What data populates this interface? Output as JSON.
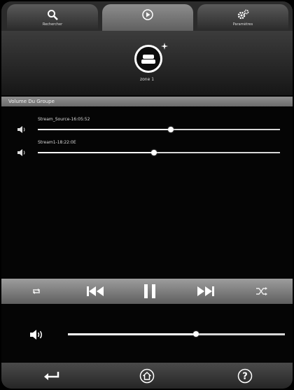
{
  "tabs": [
    {
      "label": "Rechercher",
      "icon": "search-icon"
    },
    {
      "label": "",
      "icon": "play-circle-icon"
    },
    {
      "label": "Paramètres",
      "icon": "gear-icon"
    }
  ],
  "zone": {
    "label": "zone 1",
    "icon": "speaker-group-icon"
  },
  "section": {
    "title": "Volume Du Groupe"
  },
  "streams": [
    {
      "name": "Stream_Source-16:05:52",
      "volume": 0.55
    },
    {
      "name": "Stream1-18:22:0E",
      "volume": 0.48
    }
  ],
  "transport": {
    "icons": [
      "repeat-icon",
      "previous-icon",
      "pause-icon",
      "next-icon",
      "shuffle-icon"
    ]
  },
  "master": {
    "volume": 0.59,
    "icon": "speaker-icon"
  },
  "bottom": {
    "icons": [
      "back-icon",
      "home-icon",
      "help-icon"
    ],
    "help_glyph": "?"
  },
  "colors": {
    "accent": "#ffffff",
    "header": "#7d7d7d",
    "background": "#050505"
  }
}
